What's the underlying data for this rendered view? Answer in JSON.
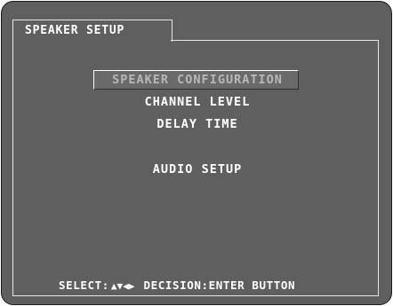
{
  "tab": {
    "title": "SPEAKER SETUP"
  },
  "menu": {
    "items": [
      {
        "label": "SPEAKER CONFIGURATION",
        "selected": true
      },
      {
        "label": "CHANNEL LEVEL",
        "selected": false
      },
      {
        "label": "DELAY TIME",
        "selected": false
      },
      {
        "label": "AUDIO SETUP",
        "selected": false
      }
    ]
  },
  "footer": {
    "select_label": "SELECT:",
    "select_arrows": "▲▼◀▶",
    "decision_label": "DECISION:ENTER BUTTON"
  },
  "colors": {
    "background": "#5f5f5f",
    "text": "#ffffff",
    "selected_text": "#b8b8b8"
  }
}
